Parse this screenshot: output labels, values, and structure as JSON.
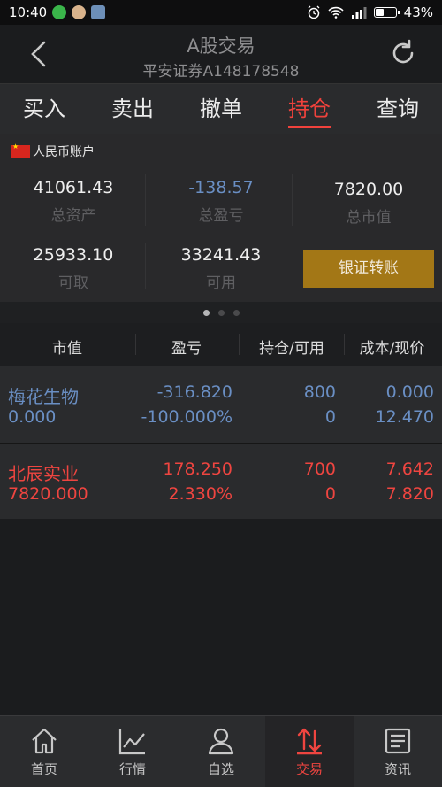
{
  "status_bar": {
    "time": "10:40",
    "battery": "43%",
    "battery_level": 0.43
  },
  "header": {
    "title": "A股交易",
    "subtitle": "平安证券A148178548"
  },
  "tabs": [
    {
      "label": "买入",
      "active": false
    },
    {
      "label": "卖出",
      "active": false
    },
    {
      "label": "撤单",
      "active": false
    },
    {
      "label": "持仓",
      "active": true
    },
    {
      "label": "查询",
      "active": false
    }
  ],
  "account": {
    "currency_label": "人民币账户",
    "total_assets": {
      "value": "41061.43",
      "label": "总资产"
    },
    "total_pl": {
      "value": "-138.57",
      "label": "总盈亏"
    },
    "market_value": {
      "value": "7820.00",
      "label": "总市值"
    },
    "withdrawable": {
      "value": "25933.10",
      "label": "可取"
    },
    "available": {
      "value": "33241.43",
      "label": "可用"
    },
    "transfer_button": "银证转账"
  },
  "table": {
    "headers": [
      "市值",
      "盈亏",
      "持仓/可用",
      "成本/现价"
    ],
    "rows": [
      {
        "name": "梅花生物",
        "market_value": "0.000",
        "pl": "-316.820",
        "pl_pct": "-100.000%",
        "position": "800",
        "available": "0",
        "cost": "0.000",
        "price": "12.470",
        "color": "#6a8fc4"
      },
      {
        "name": "北辰实业",
        "market_value": "7820.000",
        "pl": "178.250",
        "pl_pct": "2.330%",
        "position": "700",
        "available": "0",
        "cost": "7.642",
        "price": "7.820",
        "color": "#ef4540"
      }
    ]
  },
  "bottom_nav": [
    {
      "label": "首页",
      "icon": "home-icon",
      "active": false
    },
    {
      "label": "行情",
      "icon": "chart-icon",
      "active": false
    },
    {
      "label": "自选",
      "icon": "user-icon",
      "active": false
    },
    {
      "label": "交易",
      "icon": "trade-icon",
      "active": true
    },
    {
      "label": "资讯",
      "icon": "news-icon",
      "active": false
    }
  ]
}
